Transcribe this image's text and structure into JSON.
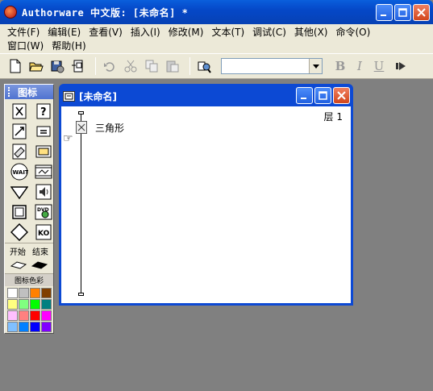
{
  "window": {
    "title": "Authorware 中文版: [未命名] *"
  },
  "menu": {
    "row1": [
      "文件(F)",
      "编辑(E)",
      "查看(V)",
      "插入(I)",
      "修改(M)",
      "文本(T)",
      "调试(C)",
      "其他(X)",
      "命令(O)"
    ],
    "row2": [
      "窗口(W)",
      "帮助(H)"
    ]
  },
  "toolbar": {
    "style_value": "",
    "bold_label": "B",
    "italic_label": "I",
    "underline_label": "U"
  },
  "palette": {
    "title": "图标",
    "start_label": "开始",
    "end_label": "结束",
    "colors_label": "图标色彩",
    "wait_label": "WAIT",
    "dvd_label": "DVD",
    "ko_label": "KO",
    "swatches": [
      "#ffffff",
      "#c0c0c0",
      "#ff8000",
      "#804000",
      "#ffff80",
      "#80ff80",
      "#00ff00",
      "#008080",
      "#ffc0ff",
      "#ff8080",
      "#ff0000",
      "#ff00ff",
      "#80c0ff",
      "#0080ff",
      "#0000ff",
      "#8000ff"
    ]
  },
  "flowchart_window": {
    "title": "[未命名]",
    "layer_label": "层 1",
    "node_label": "三角形"
  }
}
